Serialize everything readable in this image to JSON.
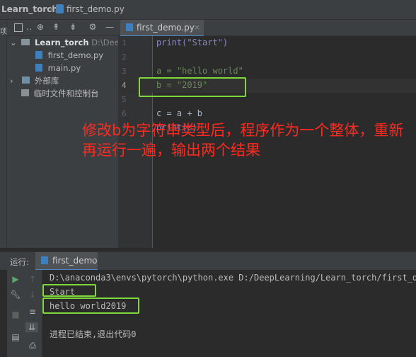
{
  "breadcrumb": {
    "project": "Learn_torch",
    "file": "first_demo.py"
  },
  "side_strip_label": "项",
  "project_panel": {
    "items": [
      {
        "label": "Learn_torch",
        "path": "D:\\DeepLe"
      },
      {
        "label": "first_demo.py"
      },
      {
        "label": "main.py"
      },
      {
        "label": "外部库"
      },
      {
        "label": "临时文件和控制台"
      }
    ]
  },
  "editor": {
    "tab_label": "first_demo.py",
    "lines": [
      {
        "num": "1",
        "code": "print(\"Start\")"
      },
      {
        "num": "2",
        "code": ""
      },
      {
        "num": "3",
        "code": "a = \"hello world\""
      },
      {
        "num": "4",
        "code": "b = \"2019\""
      },
      {
        "num": "5",
        "code": ""
      },
      {
        "num": "6",
        "code": "c = a + b"
      },
      {
        "num": "7",
        "code": "print(c)"
      }
    ]
  },
  "annotation": "修改b为字符串类型后，程序作为一个整体，重新再运行一遍，输出两个结果",
  "run_panel": {
    "label": "运行:",
    "tab_label": "first_demo",
    "output": [
      "D:\\anaconda3\\envs\\pytorch\\python.exe D:/DeepLearning/Learn_torch/first_d",
      "Start",
      "hello world2019",
      "",
      "进程已结束,退出代码0"
    ]
  }
}
